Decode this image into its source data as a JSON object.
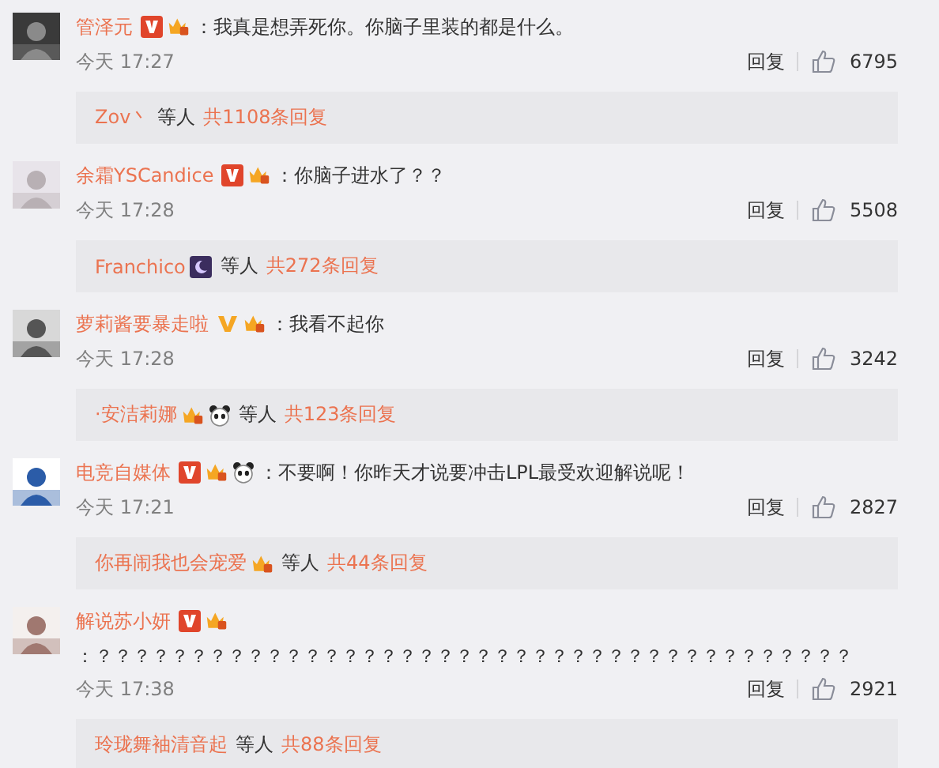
{
  "comments": [
    {
      "user": "管泽元",
      "badges": [
        {
          "kind": "verified"
        },
        {
          "kind": "crown"
        }
      ],
      "text": "：我真是想弄死你。你脑子里装的都是什么。",
      "text_below": false,
      "time": "今天 17:27",
      "reply_label": "回复",
      "likes": "6795",
      "replies": {
        "user": "Zov丶",
        "others": "等人",
        "count": "共1108条回复"
      }
    },
    {
      "user": "余霜YSCandice",
      "badges": [
        {
          "kind": "verified"
        },
        {
          "kind": "crown"
        }
      ],
      "text": "：你脑子进水了？？",
      "text_below": false,
      "time": "今天 17:28",
      "reply_label": "回复",
      "likes": "5508",
      "replies": {
        "user": "Franchico",
        "badges": [
          {
            "kind": "night"
          }
        ],
        "others": "等人",
        "count": "共272条回复"
      }
    },
    {
      "user": "萝莉酱要暴走啦",
      "badges": [
        {
          "kind": "verified-plain"
        },
        {
          "kind": "crown"
        }
      ],
      "text": "：我看不起你",
      "text_below": false,
      "time": "今天 17:28",
      "reply_label": "回复",
      "likes": "3242",
      "replies": {
        "user": "·安洁莉娜",
        "badges": [
          {
            "kind": "crown"
          },
          {
            "kind": "panda"
          }
        ],
        "others": "等人",
        "count": "共123条回复"
      }
    },
    {
      "user": "电竞自媒体",
      "badges": [
        {
          "kind": "verified"
        },
        {
          "kind": "crown"
        },
        {
          "kind": "panda"
        }
      ],
      "text": "：不要啊！你昨天才说要冲击LPL最受欢迎解说呢！",
      "text_below": false,
      "time": "今天 17:21",
      "reply_label": "回复",
      "likes": "2827",
      "replies": {
        "user": "你再闹我也会宠爱",
        "badges": [
          {
            "kind": "crown"
          }
        ],
        "others": "等人",
        "count": "共44条回复"
      }
    },
    {
      "user": "解说苏小妍",
      "badges": [
        {
          "kind": "verified"
        },
        {
          "kind": "crown"
        }
      ],
      "text": "：？？？？？？？？？？？？？？？？？？？？？？？？？？？？？？？？？？？？？？？？",
      "text_below": true,
      "time": "今天 17:38",
      "reply_label": "回复",
      "likes": "2921",
      "replies": {
        "user": "玲珑舞袖清音起",
        "others": "等人",
        "count": "共88条回复"
      }
    }
  ]
}
